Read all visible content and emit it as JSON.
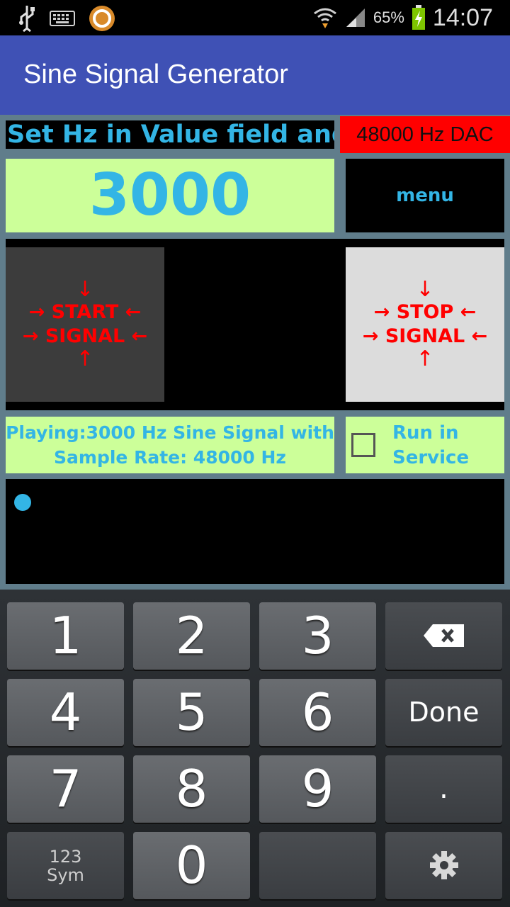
{
  "status_bar": {
    "icons": [
      "usb-icon",
      "keyboard-icon",
      "app-notification-icon"
    ],
    "right_icons": [
      "wifi-icon",
      "signal-icon"
    ],
    "battery_percent": "65%",
    "time": "14:07"
  },
  "action_bar": {
    "title": "Sine Signal Generator"
  },
  "hint": {
    "text": "Set Hz in Value field and.."
  },
  "dac": {
    "label": "48000 Hz DAC",
    "color": "#ff0000"
  },
  "value_field": {
    "value": "3000"
  },
  "menu": {
    "label": "menu"
  },
  "start_button": {
    "arrow_top": "↓",
    "line1": "→ START ←",
    "line2": "→ SIGNAL ←",
    "arrow_bottom": "↑"
  },
  "stop_button": {
    "arrow_top": "↓",
    "line1": "→ STOP ←",
    "line2": "→ SIGNAL ←",
    "arrow_bottom": "↑"
  },
  "status": {
    "line1": "Playing:3000 Hz Sine Signal with",
    "line2": "Sample Rate: 48000 Hz"
  },
  "service": {
    "line1": "Run in",
    "line2": "Service",
    "checked": false
  },
  "colors": {
    "accent": "#33b5e5",
    "action_bar": "#3f51b5",
    "field_bg": "#ccff99",
    "signal_red": "#ff0000"
  },
  "keyboard": {
    "keys": [
      "1",
      "2",
      "3",
      "4",
      "5",
      "6",
      "7",
      "8",
      "9",
      "0"
    ],
    "done_label": "Done",
    "dot_label": ".",
    "sym_line1": "123",
    "sym_line2": "Sym",
    "backspace_icon": "backspace-icon",
    "settings_icon": "gear-icon"
  }
}
